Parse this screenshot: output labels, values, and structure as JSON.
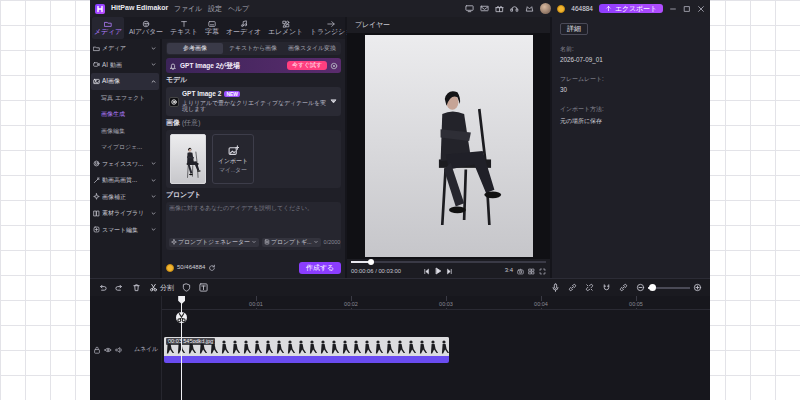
{
  "app": {
    "name": "HitPaw Edimakor",
    "menu": [
      "ファイル",
      "設定",
      "ヘルプ"
    ],
    "coins": "464884",
    "export": "エクスポート"
  },
  "tabs": [
    {
      "label": "メディア",
      "selected": true
    },
    {
      "label": "AIアバター",
      "selected": false
    },
    {
      "label": "テキスト",
      "selected": false
    },
    {
      "label": "字幕",
      "selected": false
    },
    {
      "label": "オーディオ",
      "selected": false
    },
    {
      "label": "エレメント",
      "selected": false
    },
    {
      "label": "トランジショ",
      "selected": false
    }
  ],
  "sidebar": {
    "items": [
      {
        "label": "メディア",
        "expanded": false,
        "selected": false,
        "children": []
      },
      {
        "label": "AI 動画",
        "expanded": false,
        "selected": false,
        "children": []
      },
      {
        "label": "AI画像",
        "expanded": true,
        "selected": true,
        "children": [
          {
            "label": "写真 エフェクト",
            "selected": false
          },
          {
            "label": "画像生成",
            "selected": true
          },
          {
            "label": "画像編集",
            "selected": false
          },
          {
            "label": "マイプロジェ...",
            "selected": false
          }
        ]
      },
      {
        "label": "フェイススワ...",
        "expanded": false,
        "selected": false,
        "children": []
      },
      {
        "label": "動画高画質...",
        "expanded": false,
        "selected": false,
        "children": []
      },
      {
        "label": "画像補正",
        "expanded": false,
        "selected": false,
        "children": []
      },
      {
        "label": "素材ライブラリ",
        "expanded": false,
        "selected": false,
        "children": []
      },
      {
        "label": "スマート編集",
        "expanded": false,
        "selected": false,
        "children": []
      }
    ]
  },
  "panel": {
    "subtabs": [
      {
        "label": "参考画像",
        "selected": true
      },
      {
        "label": "テキストから画像",
        "selected": false
      },
      {
        "label": "画像スタイル変換",
        "selected": false
      }
    ],
    "banner": {
      "text": "GPT Image 2が登場",
      "button": "今すぐ試す"
    },
    "model_label": "モデル",
    "model": {
      "name": "GPT Image 2",
      "badge": "NEW",
      "description": "よりリアルで豊かなクリエイティブなディテールを実現します"
    },
    "image_label": "画像",
    "image_hint": "(任意)",
    "import": {
      "label": "インポート",
      "sub": "マイ...ター"
    },
    "prompt_label": "プロンプト",
    "prompt_placeholder": "画像に対するあなたのアイデアを説明してください。",
    "prompt_tools": [
      "プロンプトジェネレーター",
      "プロンプトギ..."
    ],
    "counter": "0/2000",
    "cost": "50/464884",
    "create": "作成する"
  },
  "player": {
    "title": "プレイヤー",
    "time": "00:00:06 / 00:03:00",
    "ratio": "3:4",
    "progress": 0.1
  },
  "details": {
    "tab": "詳細",
    "fields": [
      {
        "label": "名前:",
        "value": "2026-07-09_01"
      },
      {
        "label": "フレームレート:",
        "value": "30"
      },
      {
        "label": "インポート方法:",
        "value": "元の場所に保存"
      }
    ]
  },
  "timeline": {
    "split": "分割",
    "ruler": [
      "00:01",
      "00:02",
      "00:03",
      "00:04",
      "00:05"
    ],
    "track_label": "ムネイル",
    "clip": "00:03 545odkd.jpg",
    "playhead": 0.035,
    "zoom": 0.1
  }
}
